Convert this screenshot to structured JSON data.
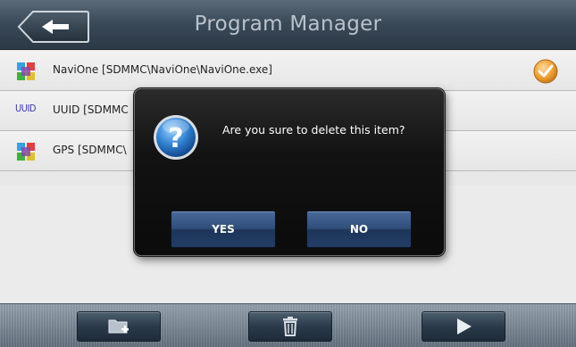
{
  "header": {
    "title": "Program Manager",
    "back_icon": "arrow-left-icon"
  },
  "list": {
    "items": [
      {
        "icon": "app-cube-icon",
        "label": "NaviOne [SDMMC\\NaviOne\\NaviOne.exe]",
        "checked": true
      },
      {
        "icon_text": "UUID",
        "label": "UUID [SDMMC"
      },
      {
        "icon": "app-cube-icon",
        "label": "GPS [SDMMC\\"
      }
    ],
    "check_icon": "checkmark-circle-icon"
  },
  "toolbar": {
    "buttons": [
      {
        "icon": "add-folder-icon"
      },
      {
        "icon": "trash-icon"
      },
      {
        "icon": "play-icon"
      }
    ]
  },
  "dialog": {
    "icon": "question-icon",
    "message": "Are you sure to delete this item?",
    "yes_label": "YES",
    "no_label": "NO"
  },
  "colors": {
    "header_bg": "#3b4a59",
    "header_title": "#b9c2cb",
    "dialog_bg": "#121212",
    "dialog_button": "#2f4d7a",
    "check_orange": "#f0a030"
  }
}
